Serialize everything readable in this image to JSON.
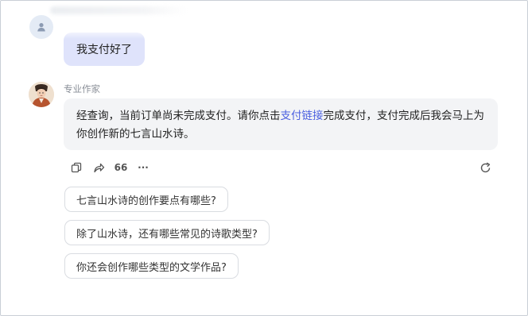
{
  "user_message": {
    "text": "我支付好了"
  },
  "bot": {
    "name": "专业作家",
    "reply_before_link": "经查询，当前订单尚未完成支付。请你点击",
    "reply_link": "支付链接",
    "reply_after_link": "完成支付，支付完成后我会马上为你创作新的七言山水诗。"
  },
  "actions": {
    "copy_icon": "copy-icon",
    "share_icon": "share-icon",
    "quote_label": "66",
    "more_label": "···",
    "refresh_icon": "refresh-icon"
  },
  "suggestions": [
    "七言山水诗的创作要点有哪些?",
    "除了山水诗，还有哪些常见的诗歌类型?",
    "你还会创作哪些类型的文学作品?"
  ],
  "colors": {
    "user_bubble": "#dfe3fb",
    "bot_bubble": "#f3f4f6",
    "link": "#4a5fe0"
  }
}
